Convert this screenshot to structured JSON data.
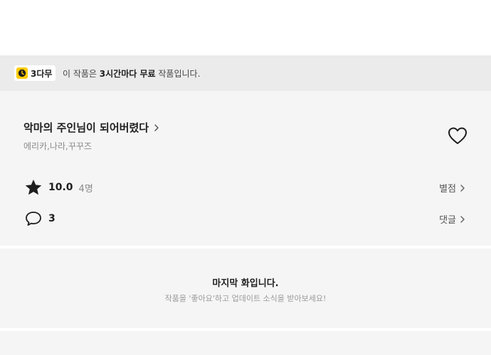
{
  "notice": {
    "badge_label": "3다무",
    "text_prefix": "이 작품은 ",
    "text_bold": "3시간마다 무료",
    "text_suffix": " 작품입니다."
  },
  "work": {
    "title": "악마의 주인님이 되어버렸다",
    "authors": "에리카,나라,꾸꾸즈"
  },
  "rating": {
    "value": "10.0",
    "count": "4명",
    "link_label": "별점"
  },
  "comments": {
    "count": "3",
    "link_label": "댓글"
  },
  "end_message": {
    "title": "마지막 화입니다.",
    "subtitle": "작품을 '좋아요'하고 업데이트 소식을 받아보세요!"
  },
  "icons": {
    "badge": "clock-icon",
    "title_arrow": "chevron-right-icon",
    "like": "heart-outline-icon",
    "rating": "star-icon",
    "comment": "speech-bubble-icon"
  },
  "colors": {
    "badge_accent": "#ffcc00",
    "notice_bg": "#ebebeb",
    "panel_bg": "#f5f5f5"
  }
}
